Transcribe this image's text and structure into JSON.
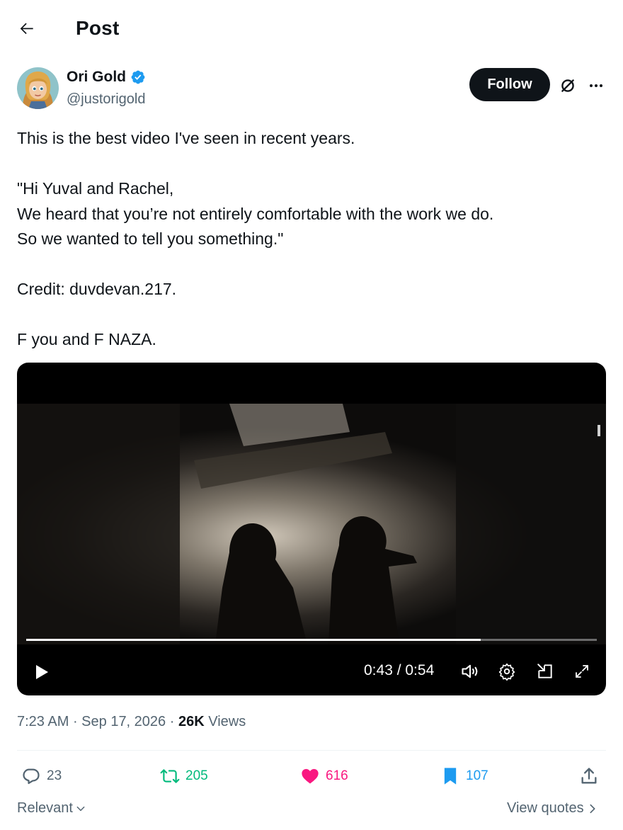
{
  "header": {
    "title": "Post",
    "back_icon": "arrow-left-icon"
  },
  "author": {
    "name": "Ori Gold",
    "handle": "@justorigold",
    "verified": true
  },
  "actions_top": {
    "follow_label": "Follow",
    "grok_icon": "slashed-circle-icon",
    "more_icon": "more-icon"
  },
  "post": {
    "text_lines": [
      "This is the best video I've seen in recent years.",
      "",
      "\"Hi Yuval and Rachel,",
      "We heard that you’re not entirely comfortable with the work we do.",
      "So we wanted to tell you something.\"",
      "",
      "Credit: duvdevan.217.",
      "",
      "F you and F NAZA."
    ]
  },
  "video": {
    "time_display": "0:43 / 0:54",
    "progress": 0.796,
    "play_icon": "play-icon",
    "volume_icon": "volume-icon",
    "settings_icon": "gear-icon",
    "pip_icon": "picture-in-picture-icon",
    "fullscreen_icon": "fullscreen-icon"
  },
  "meta": {
    "time": "7:23 AM",
    "separator": " · ",
    "date": "Sep 17, 2026",
    "views_count": "26K",
    "views_label": "Views"
  },
  "stats": {
    "replies": "23",
    "reposts": "205",
    "likes": "616",
    "bookmarks": "107"
  },
  "colors": {
    "repost_green": "#00ba7c",
    "like_pink": "#f91880",
    "bookmark_blue": "#1d9bf0",
    "verified_blue": "#1d9bf0"
  },
  "footer": {
    "sort_label": "Relevant",
    "view_quotes_label": "View quotes"
  }
}
